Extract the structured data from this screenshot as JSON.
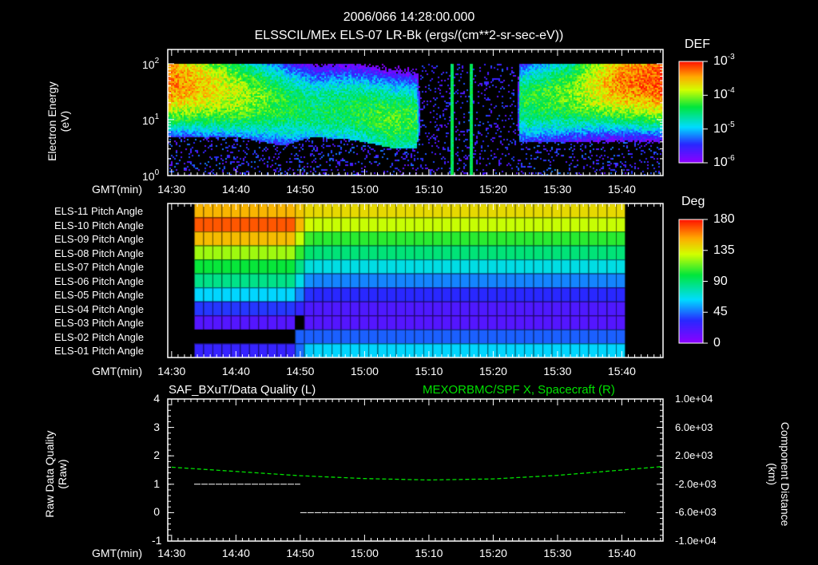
{
  "header": {
    "datetime": "2006/066 14:28:00.000",
    "subtitle": "ELSSCIL/MEx ELS-07 LR-Bk  (ergs/(cm**2-sr-sec-eV))"
  },
  "colors": {
    "background": "#000000",
    "text": "#ffffff",
    "right_series": "#00e000"
  },
  "chart_data": [
    {
      "type": "heatmap",
      "title": "ELSSCIL/MEx ELS-07 LR-Bk  (ergs/(cm**2-sr-sec-eV))",
      "xlabel": "GMT(min)",
      "ylabel_line1": "Electron Energy",
      "ylabel_line2": "(eV)",
      "x_ticks": [
        "14:30",
        "14:40",
        "14:50",
        "15:00",
        "15:10",
        "15:20",
        "15:30",
        "15:40"
      ],
      "x_tick_minutes": [
        30,
        40,
        50,
        60,
        70,
        80,
        90,
        100
      ],
      "xlim_minutes_after_14h": [
        29.4,
        106.4
      ],
      "yscale": "log",
      "ylim": [
        1,
        180
      ],
      "y_ticks": [
        {
          "base": "10",
          "exp": "0"
        },
        {
          "base": "10",
          "exp": "1"
        },
        {
          "base": "10",
          "exp": "2"
        }
      ],
      "colorbar": {
        "label": "DEF",
        "scale": "log",
        "range": [
          1e-06,
          0.001
        ],
        "ticks": [
          {
            "base": "10",
            "exp": "-3"
          },
          {
            "base": "10",
            "exp": "-4"
          },
          {
            "base": "10",
            "exp": "-5"
          },
          {
            "base": "10",
            "exp": "-6"
          }
        ]
      },
      "time_profile": [
        {
          "t": 29.4,
          "peak_log": -3.3,
          "low_cut": 5,
          "peak_e": 50
        },
        {
          "t": 35,
          "peak_log": -3.6,
          "low_cut": 5,
          "peak_e": 40
        },
        {
          "t": 40,
          "peak_log": -3.9,
          "low_cut": 5,
          "peak_e": 30
        },
        {
          "t": 47,
          "peak_log": -4.3,
          "low_cut": 3.5,
          "peak_e": 20
        },
        {
          "t": 52,
          "peak_log": -4.5,
          "low_cut": 5,
          "peak_e": 15
        },
        {
          "t": 58,
          "peak_log": -4.4,
          "low_cut": 4.5,
          "peak_e": 15
        },
        {
          "t": 64,
          "peak_log": -4.2,
          "low_cut": 3.2,
          "peak_e": 10
        },
        {
          "t": 68,
          "peak_log": -4.3,
          "low_cut": 3.2,
          "peak_e": 10
        },
        {
          "t": 69,
          "peak_log": -7,
          "low_cut": 10,
          "peak_e": 10
        },
        {
          "t": 83.5,
          "peak_log": -7,
          "low_cut": 10,
          "peak_e": 10
        },
        {
          "t": 84,
          "peak_log": -4.4,
          "low_cut": 4,
          "peak_e": 20
        },
        {
          "t": 92,
          "peak_log": -4.1,
          "low_cut": 4,
          "peak_e": 30
        },
        {
          "t": 99,
          "peak_log": -3.4,
          "low_cut": 4,
          "peak_e": 50
        },
        {
          "t": 106.4,
          "peak_log": -3.1,
          "low_cut": 4,
          "peak_e": 55
        }
      ],
      "spikes_minutes": [
        73.5,
        76.5
      ]
    },
    {
      "type": "heatmap",
      "xlabel": "GMT(min)",
      "rows": [
        "ELS-11 Pitch Angle",
        "ELS-10 Pitch Angle",
        "ELS-09 Pitch Angle",
        "ELS-08 Pitch Angle",
        "ELS-07 Pitch Angle",
        "ELS-06 Pitch Angle",
        "ELS-05 Pitch Angle",
        "ELS-04 Pitch Angle",
        "ELS-03 Pitch Angle",
        "ELS-02 Pitch Angle",
        "ELS-01 Pitch Angle"
      ],
      "x_ticks": [
        "14:30",
        "14:40",
        "14:50",
        "15:00",
        "15:10",
        "15:20",
        "15:30",
        "15:40"
      ],
      "data_time_range_minutes": [
        33.5,
        100.5
      ],
      "transition_minute": 50,
      "pitch_before_deg": [
        150,
        168,
        148,
        122,
        100,
        85,
        62,
        35,
        18,
        null,
        28
      ],
      "pitch_after_deg": [
        140,
        128,
        105,
        88,
        68,
        48,
        32,
        20,
        18,
        42,
        62
      ],
      "colorbar": {
        "label": "Deg",
        "range": [
          0,
          180
        ],
        "ticks": [
          "180",
          "135",
          "90",
          "45",
          "0"
        ]
      }
    },
    {
      "type": "line",
      "title_left": "SAF_BXuT/Data Quality (L)",
      "title_right": "MEXORBMC/SPF X, Spacecraft (R)",
      "xlabel": "GMT(min)",
      "ylabel_left_line1": "Raw Data Quality",
      "ylabel_left_line2": "(Raw)",
      "ylabel_right_line1": "Component Distance",
      "ylabel_right_line2": "(km)",
      "x_ticks": [
        "14:30",
        "14:40",
        "14:50",
        "15:00",
        "15:10",
        "15:20",
        "15:30",
        "15:40"
      ],
      "ylim_left": [
        -1,
        4
      ],
      "y_ticks_left": [
        "4",
        "3",
        "2",
        "1",
        "0",
        "-1"
      ],
      "ylim_right": [
        -10000,
        10000
      ],
      "y_ticks_right": [
        "1.0e+04",
        "6.0e+03",
        "2.0e+03",
        "-2.0e+03",
        "-6.0e+03",
        "-1.0e+04"
      ],
      "series": [
        {
          "name": "Data Quality",
          "axis": "left",
          "segments": [
            {
              "x": [
                33.5,
                50
              ],
              "y": [
                1,
                1
              ]
            },
            {
              "x": [
                50,
                100.5
              ],
              "y": [
                0,
                0
              ]
            }
          ]
        },
        {
          "name": "SPF X",
          "axis": "right",
          "x": [
            30,
            40,
            50,
            60,
            70,
            80,
            90,
            100,
            106.4
          ],
          "y": [
            400,
            -200,
            -800,
            -1200,
            -1400,
            -1250,
            -750,
            0,
            500
          ]
        }
      ]
    }
  ]
}
